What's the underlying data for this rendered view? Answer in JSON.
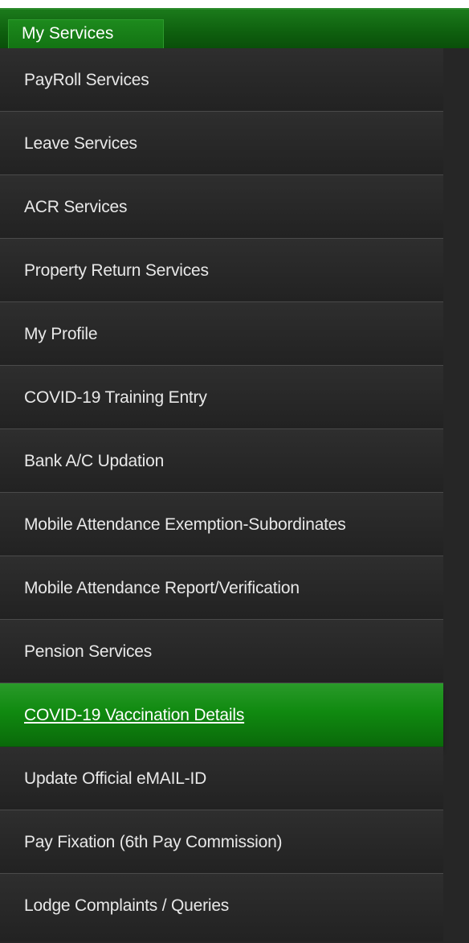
{
  "header": {
    "tab_label": "My Services"
  },
  "menu": {
    "items": [
      {
        "label": "PayRoll Services"
      },
      {
        "label": "Leave Services"
      },
      {
        "label": "ACR Services"
      },
      {
        "label": "Property Return Services"
      },
      {
        "label": "My Profile"
      },
      {
        "label": "COVID-19 Training Entry"
      },
      {
        "label": "Bank A/C Updation"
      },
      {
        "label": "Mobile Attendance Exemption-Subordinates"
      },
      {
        "label": "Mobile Attendance Report/Verification"
      },
      {
        "label": "Pension Services"
      },
      {
        "label": "COVID-19 Vaccination Details"
      },
      {
        "label": "Update Official eMAIL-ID"
      },
      {
        "label": "Pay Fixation (6th Pay Commission)"
      },
      {
        "label": "Lodge Complaints / Queries"
      }
    ],
    "active_item": "COVID-19 Vaccination Details"
  },
  "colors": {
    "accent_green": "#108a10",
    "menu_background": "#262626",
    "menu_text": "#e8e8e8"
  }
}
